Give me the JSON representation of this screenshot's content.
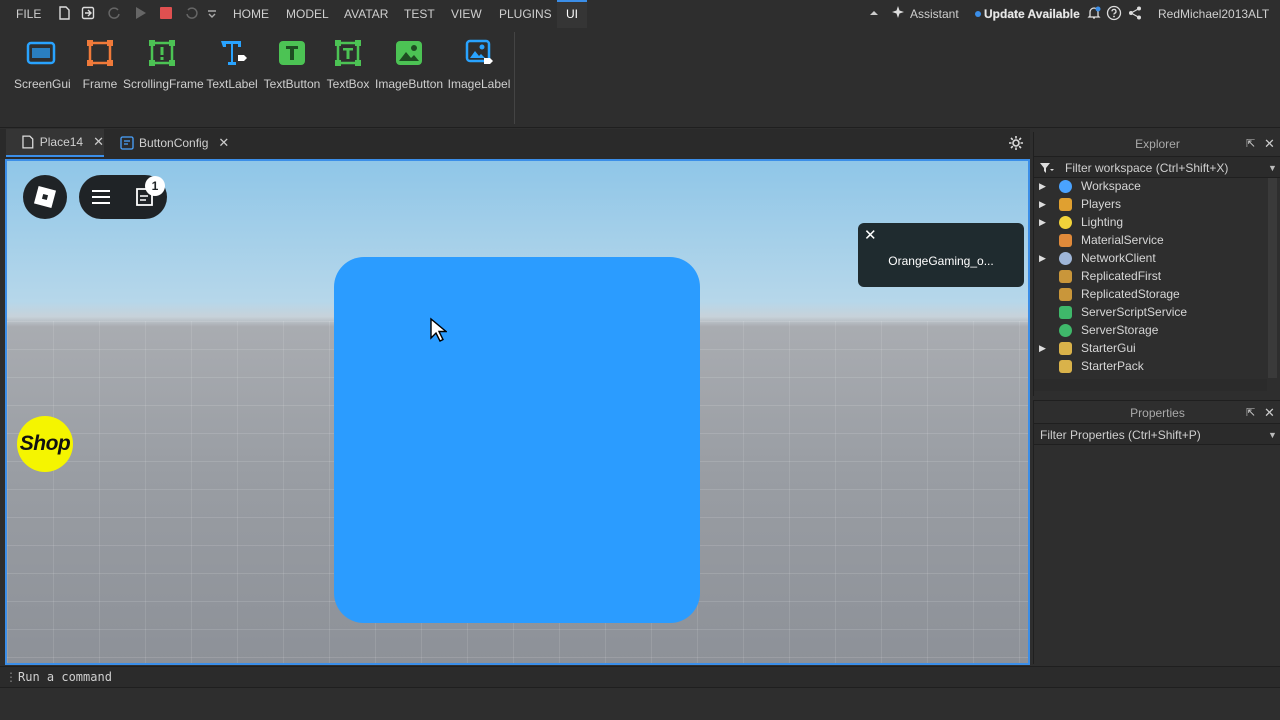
{
  "menubar": {
    "file": "FILE",
    "tabs": [
      "HOME",
      "MODEL",
      "AVATAR",
      "TEST",
      "VIEW",
      "PLUGINS",
      "UI"
    ],
    "assistant": "Assistant",
    "update": "Update Available",
    "user": "RedMichael2013ALT"
  },
  "ribbon": {
    "items": [
      {
        "label": "ScreenGui",
        "icon": "screengui-icon"
      },
      {
        "label": "Frame",
        "icon": "frame-icon"
      },
      {
        "label": "ScrollingFrame",
        "icon": "scrollingframe-icon"
      },
      {
        "label": "TextLabel",
        "icon": "textlabel-icon"
      },
      {
        "label": "TextButton",
        "icon": "textbutton-icon"
      },
      {
        "label": "TextBox",
        "icon": "textbox-icon"
      },
      {
        "label": "ImageButton",
        "icon": "imagebutton-icon"
      },
      {
        "label": "ImageLabel",
        "icon": "imagelabel-icon"
      }
    ]
  },
  "doctabs": [
    {
      "label": "Place14",
      "active": true
    },
    {
      "label": "ButtonConfig",
      "active": false
    }
  ],
  "viewport": {
    "badge_count": "1",
    "shop_label": "Shop",
    "notification_text": "OrangeGaming_o..."
  },
  "explorer": {
    "title": "Explorer",
    "filter_placeholder": "Filter workspace (Ctrl+Shift+X)",
    "items": [
      {
        "label": "Workspace",
        "expandable": true,
        "color": "#4aa3ff"
      },
      {
        "label": "Players",
        "expandable": true,
        "color": "#e0a030"
      },
      {
        "label": "Lighting",
        "expandable": true,
        "color": "#f2d33a"
      },
      {
        "label": "MaterialService",
        "expandable": false,
        "color": "#e08a3a"
      },
      {
        "label": "NetworkClient",
        "expandable": true,
        "color": "#9fb6d8"
      },
      {
        "label": "ReplicatedFirst",
        "expandable": false,
        "color": "#c9963a"
      },
      {
        "label": "ReplicatedStorage",
        "expandable": false,
        "color": "#c9963a"
      },
      {
        "label": "ServerScriptService",
        "expandable": false,
        "color": "#3fb86a"
      },
      {
        "label": "ServerStorage",
        "expandable": false,
        "color": "#3fb86a"
      },
      {
        "label": "StarterGui",
        "expandable": true,
        "color": "#d9b24a"
      },
      {
        "label": "StarterPack",
        "expandable": false,
        "color": "#d9b24a"
      }
    ]
  },
  "properties": {
    "title": "Properties",
    "filter_placeholder": "Filter Properties (Ctrl+Shift+P)"
  },
  "command": {
    "placeholder": "Run a command"
  }
}
